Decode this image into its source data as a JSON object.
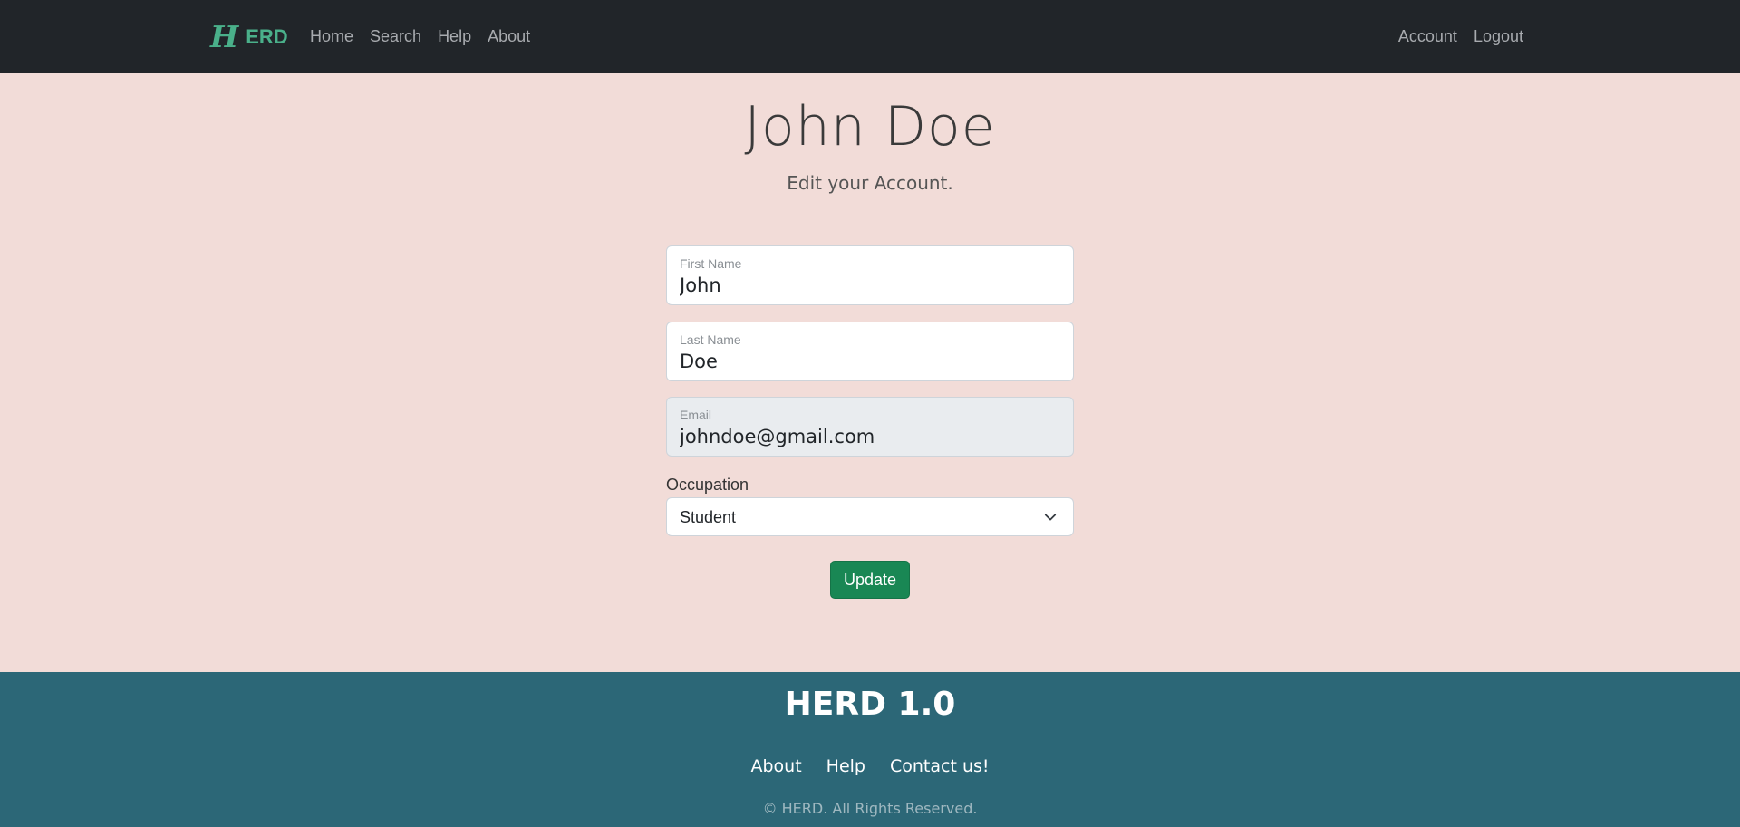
{
  "navbar": {
    "brand_letter": "H",
    "brand_text": "ERD",
    "brand_color": "#4ab08a",
    "background": "#212529",
    "left_links": [
      "Home",
      "Search",
      "Help",
      "About"
    ],
    "right_links": [
      "Account",
      "Logout"
    ]
  },
  "header": {
    "title": "John Doe",
    "subtitle": "Edit your Account."
  },
  "form": {
    "first_name": {
      "label": "First Name",
      "value": "John"
    },
    "last_name": {
      "label": "Last Name",
      "value": "Doe"
    },
    "email": {
      "label": "Email",
      "value": "johndoe@gmail.com",
      "disabled": true
    },
    "occupation": {
      "label": "Occupation",
      "selected": "Student"
    },
    "submit_label": "Update",
    "submit_color": "#198754"
  },
  "footer": {
    "title": "HERD 1.0",
    "links": [
      "About",
      "Help",
      "Contact us!"
    ],
    "copyright": "© HERD. All Rights Reserved.",
    "background": "#2c6777"
  },
  "page_background": "#f2dcd8"
}
